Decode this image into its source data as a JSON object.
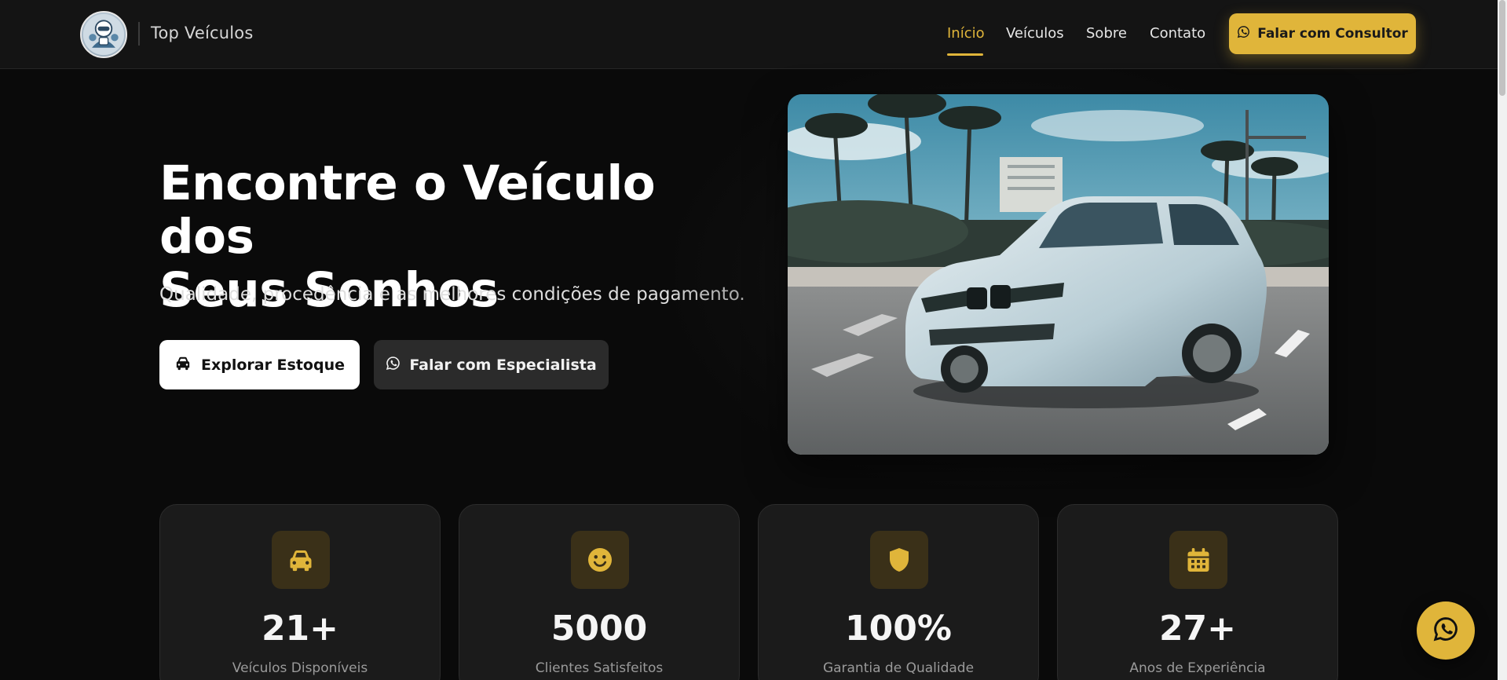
{
  "header": {
    "brand": "Top Veículos",
    "nav": [
      {
        "label": "Início",
        "active": true
      },
      {
        "label": "Veículos",
        "active": false
      },
      {
        "label": "Sobre",
        "active": false
      },
      {
        "label": "Contato",
        "active": false
      }
    ],
    "cta_label": "Falar com Consultor"
  },
  "hero": {
    "title_line1": "Encontre o Veículo dos",
    "title_line2": "Seus Sonhos",
    "subtitle": "Qualidade, procedência e as melhores condições de pagamento.",
    "primary_button": "Explorar Estoque",
    "secondary_button": "Falar com Especialista"
  },
  "stats": [
    {
      "icon": "car-icon",
      "value": "21+",
      "label": "Veículos Disponíveis"
    },
    {
      "icon": "smile-icon",
      "value": "5000",
      "label": "Clientes Satisfeitos"
    },
    {
      "icon": "shield-icon",
      "value": "100%",
      "label": "Garantia de Qualidade"
    },
    {
      "icon": "calendar-icon",
      "value": "27+",
      "label": "Anos de Experiência"
    }
  ],
  "colors": {
    "accent": "#e0b53a",
    "background": "#0a0a0a",
    "card": "#1b1b1b"
  }
}
